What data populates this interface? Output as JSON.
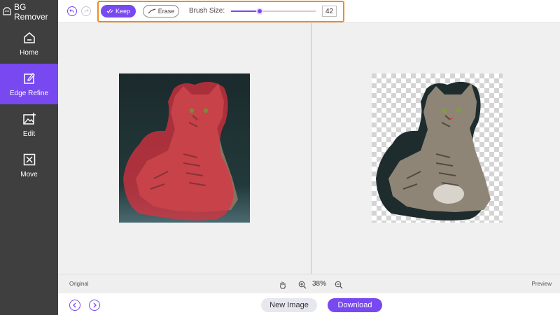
{
  "app": {
    "title": "BG Remover"
  },
  "sidebar": {
    "items": [
      {
        "label": "Home",
        "icon": "home-icon",
        "active": false
      },
      {
        "label": "Edge Refine",
        "icon": "edge-refine-icon",
        "active": true
      },
      {
        "label": "Edit",
        "icon": "image-edit-icon",
        "active": false
      },
      {
        "label": "Move",
        "icon": "move-icon",
        "active": false
      }
    ]
  },
  "toolbar": {
    "keep_label": "Keep",
    "erase_label": "Erase",
    "brush_size_label": "Brush Size:",
    "brush_size_value": "42",
    "brush_size_fraction": 0.34
  },
  "status": {
    "original_label": "Original",
    "preview_label": "Preview",
    "zoom": "38%"
  },
  "footer": {
    "new_image_label": "New Image",
    "download_label": "Download"
  },
  "colors": {
    "accent": "#7848f0",
    "sidebar_bg": "#3f3f3f",
    "highlight_frame": "#f28c1e",
    "mask_overlay": "#e03040"
  }
}
